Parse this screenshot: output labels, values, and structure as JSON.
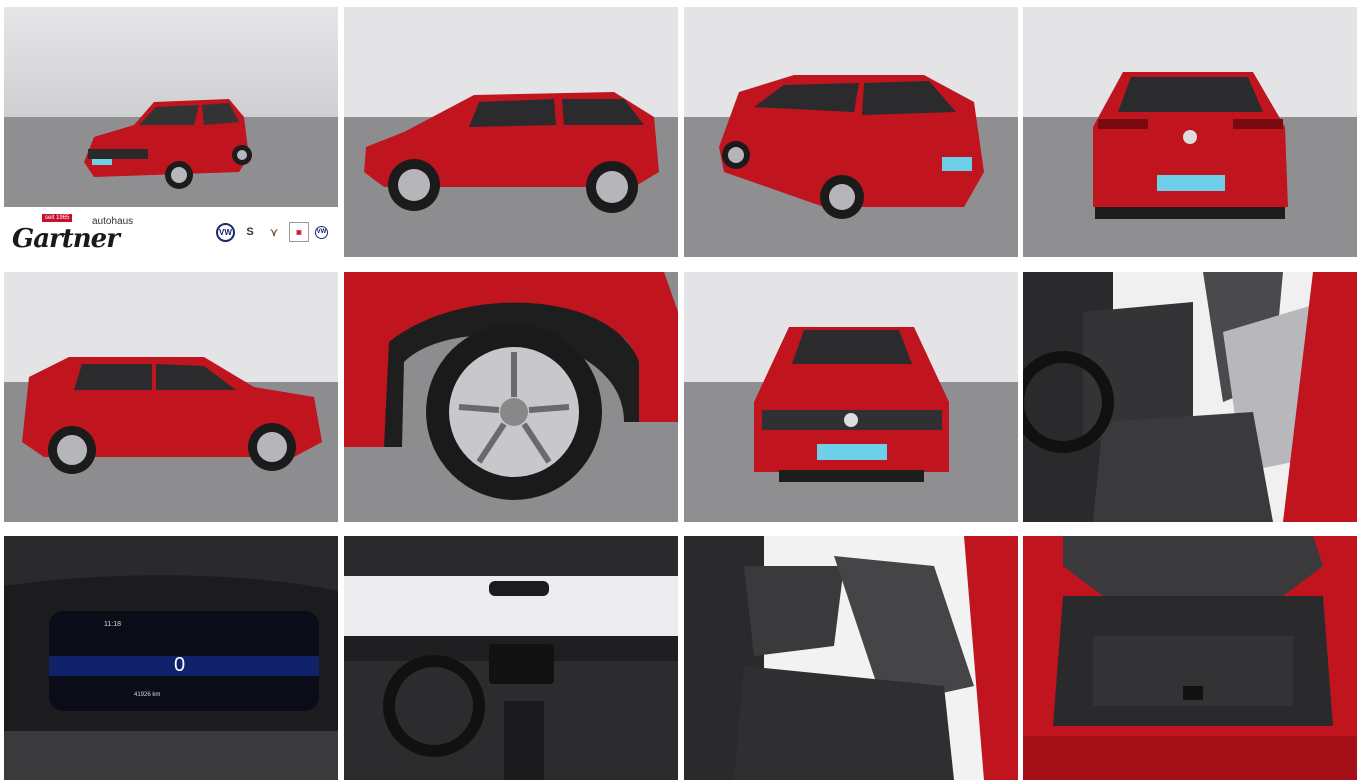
{
  "dealer": {
    "tag": "seit 1965",
    "autohaus": "autohaus",
    "name": "Gartner"
  },
  "brands": [
    {
      "name": "vw-logo",
      "mark": "VW"
    },
    {
      "name": "seat-logo",
      "mark": "S"
    },
    {
      "name": "cupra-logo",
      "mark": "⋎"
    },
    {
      "name": "service-logo",
      "mark": "▣"
    },
    {
      "name": "vw-nutzfahrzeuge-logo",
      "mark": "VW"
    }
  ],
  "photos": [
    {
      "id": "front-three-quarter"
    },
    {
      "id": "side-left"
    },
    {
      "id": "rear-three-quarter"
    },
    {
      "id": "rear"
    },
    {
      "id": "side-right"
    },
    {
      "id": "wheel-detail"
    },
    {
      "id": "front"
    },
    {
      "id": "front-seats"
    },
    {
      "id": "instrument-cluster"
    },
    {
      "id": "dashboard"
    },
    {
      "id": "rear-seats"
    },
    {
      "id": "trunk"
    }
  ],
  "cluster": {
    "time": "11:18",
    "speed": "0",
    "odometer": "41926 km"
  },
  "colors": {
    "car_red": "#c0141e",
    "showroom_top": "#e6e6e8",
    "showroom_floor": "#8a8a8c",
    "interior_dark": "#2a2a2c",
    "cluster_blue": "#1a3fcf"
  }
}
